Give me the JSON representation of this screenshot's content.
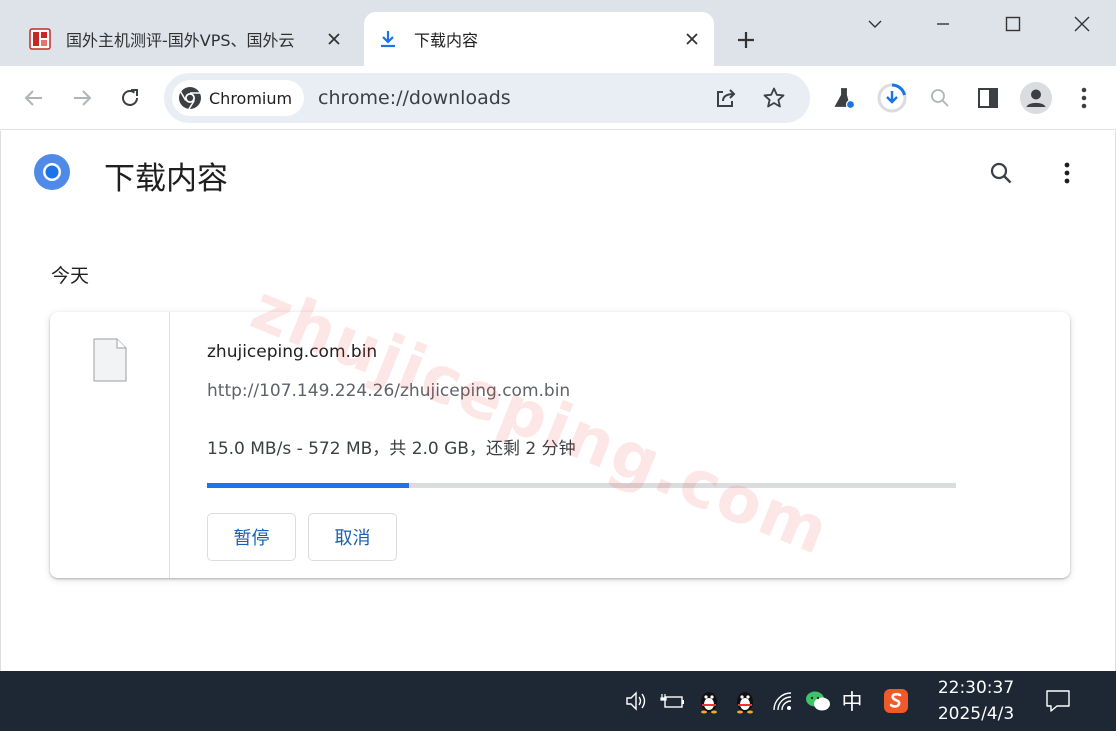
{
  "tabs": [
    {
      "title": "国外主机测评-国外VPS、国外云",
      "favicon": "site-seal-icon",
      "active": false
    },
    {
      "title": "下载内容",
      "favicon": "download-icon",
      "active": true
    }
  ],
  "toolbar": {
    "site_chip": "Chromium",
    "url": "chrome://downloads",
    "icons": [
      "back-icon",
      "forward-icon",
      "reload-icon",
      "share-icon",
      "bookmark-star-icon",
      "labs-flask-icon",
      "downloads-icon",
      "zoom-icon",
      "side-panel-icon",
      "profile-icon",
      "menu-icon"
    ]
  },
  "page": {
    "title": "下载内容",
    "section_date": "今天"
  },
  "download": {
    "file_name": "zhujiceping.com.bin",
    "url": "http://107.149.224.26/zhujiceping.com.bin",
    "status": "15.0 MB/s - 572 MB，共 2.0 GB，还剩 2 分钟",
    "progress": 0.27,
    "pause_label": "暂停",
    "cancel_label": "取消"
  },
  "watermark": "zhujiceping.com",
  "taskbar": {
    "ime": "中",
    "time": "22:30:37",
    "date": "2025/4/3"
  },
  "colors": {
    "accent": "#1a73e8",
    "tabstrip": "#dee3ea",
    "taskbar": "#1e2734",
    "button_text": "#1a5fb4"
  }
}
